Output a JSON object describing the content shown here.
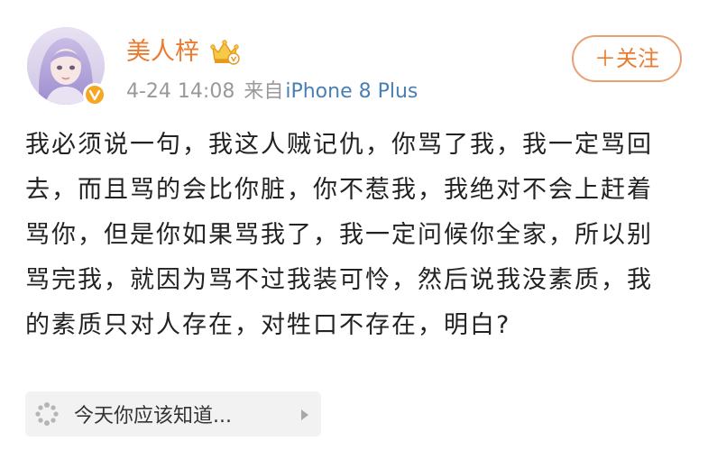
{
  "post": {
    "username": "美人梓",
    "time": "4-24 14:08",
    "source_prefix": "来自",
    "device": "iPhone 8 Plus",
    "follow_label": "＋关注",
    "body": "我必须说一句，我这人贼记仇，你骂了我，我一定骂回去，而且骂的会比你脏，你不惹我，我绝对不会上赶着骂你，但是你如果骂我了，我一定问候你全家，所以别骂完我，就因为骂不过我装可怜，然后说我没素质，我的素质只对人存在，对牲口不存在，明白?"
  },
  "suggestion": {
    "label": "今天你应该知道..."
  },
  "icons": {
    "verified": "verified-v-icon",
    "vip": "crown-vip-icon",
    "suggestion": "loading-spinner-icon",
    "arrow": "chevron-right-icon"
  },
  "colors": {
    "username": "#ea7b2f",
    "device_link": "#4a7fb6",
    "meta": "#999999",
    "verified_badge": "#f5a623",
    "body_text": "#222222",
    "card_bg": "#f2f2f2"
  }
}
